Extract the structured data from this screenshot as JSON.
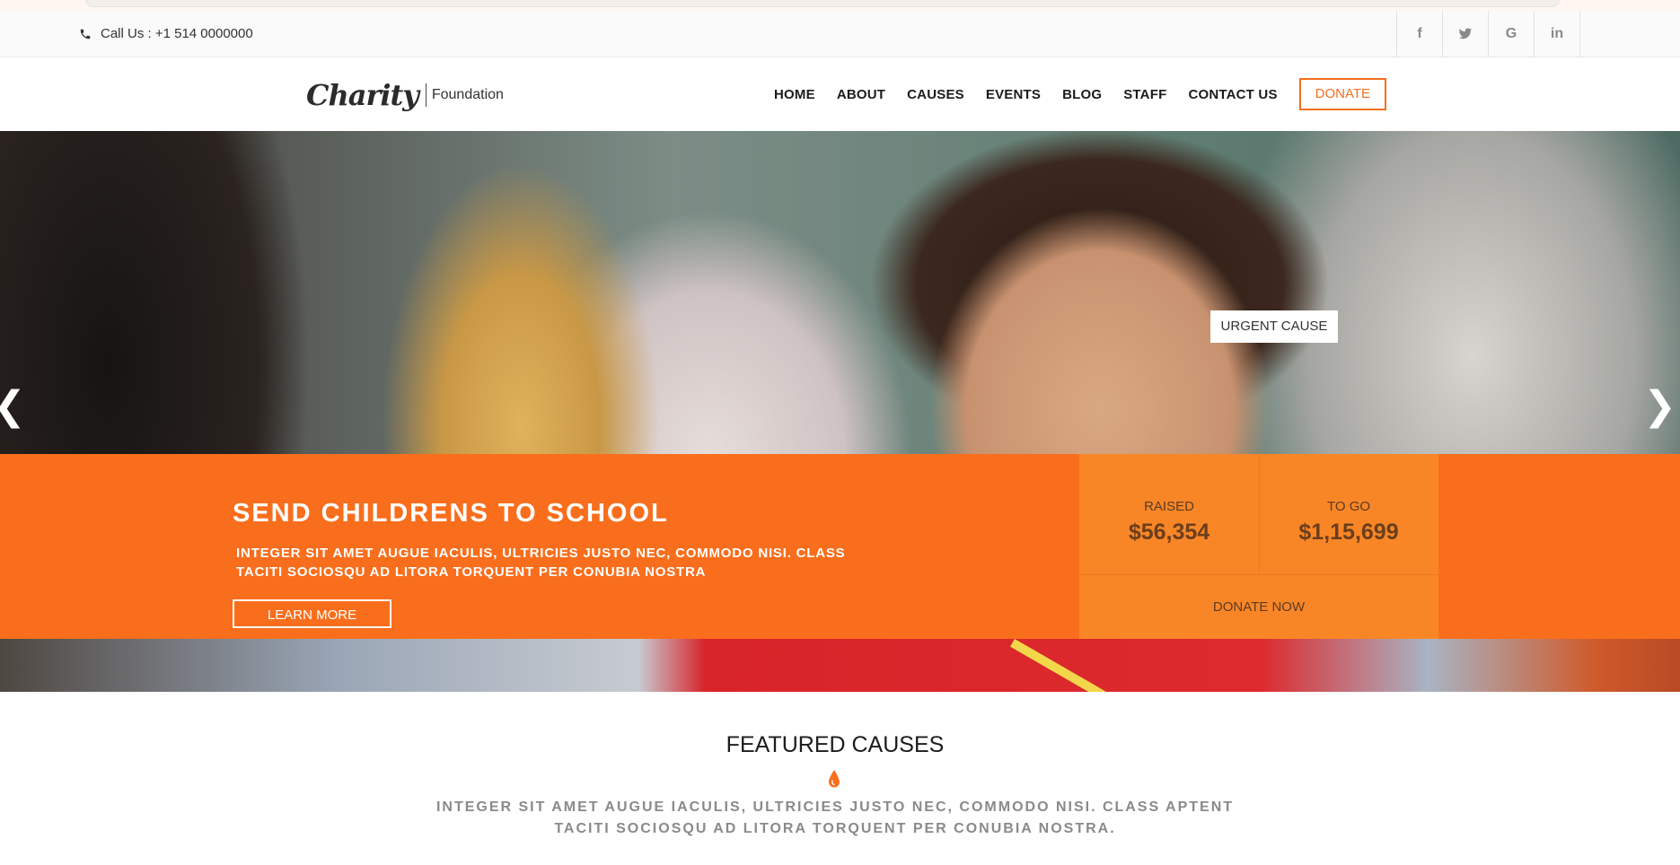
{
  "topbar": {
    "call_text": "Call Us : +1 514 0000000",
    "socials": [
      {
        "icon": "facebook-icon",
        "glyph": "f"
      },
      {
        "icon": "twitter-icon",
        "glyph": "t"
      },
      {
        "icon": "google-icon",
        "glyph": "G"
      },
      {
        "icon": "linkedin-icon",
        "glyph": "in"
      }
    ]
  },
  "header": {
    "logo_script": "Charity",
    "logo_sub": "Foundation",
    "nav": [
      "HOME",
      "ABOUT",
      "CAUSES",
      "EVENTS",
      "BLOG",
      "STAFF",
      "CONTACT US"
    ],
    "donate_label": "DONATE"
  },
  "hero": {
    "badge": "URGENT CAUSE",
    "title": "SEND CHILDRENS TO SCHOOL",
    "text": "INTEGER SIT AMET AUGUE IACULIS, ULTRICIES JUSTO NEC, COMMODO NISI. CLASS TACITI SOCIOSQU AD LITORA TORQUENT PER CONUBIA NOSTRA",
    "learn_more": "LEARN MORE",
    "raised_label": "RAISED",
    "raised_value": "$56,354",
    "togo_label": "TO GO",
    "togo_value": "$1,15,699",
    "donate_now": "DONATE NOW",
    "prev_icon": "chevron-left-icon",
    "next_icon": "chevron-right-icon"
  },
  "featured": {
    "title": "FEATURED CAUSES",
    "text": "INTEGER SIT AMET AUGUE IACULIS, ULTRICIES JUSTO NEC, COMMODO NISI. CLASS APTENT TACITI SOCIOSQU AD LITORA TORQUENT PER CONUBIA NOSTRA."
  },
  "colors": {
    "accent": "#f96e1c",
    "stats_bg": "#f98626",
    "nav_donate": "#f46e1f"
  }
}
